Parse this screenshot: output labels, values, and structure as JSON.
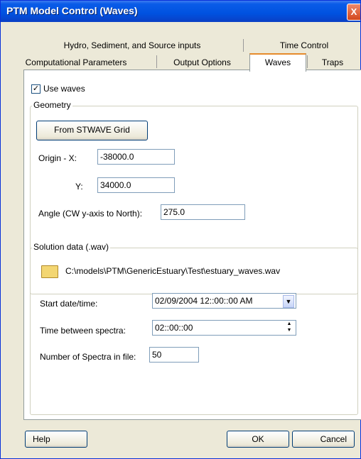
{
  "window": {
    "title": "PTM Model Control (Waves)",
    "close_glyph": "X"
  },
  "tabs": {
    "row1": [
      "Hydro, Sediment, and Source inputs",
      "Time Control"
    ],
    "row2": [
      "Computational Parameters",
      "Output Options",
      "Waves",
      "Traps"
    ],
    "active": "Waves"
  },
  "use_waves": {
    "label": "Use waves",
    "checked": true,
    "mark": "✓"
  },
  "geometry": {
    "title": "Geometry",
    "from_grid_button": "From STWAVE Grid",
    "origin_label": "Origin -  X:",
    "origin_x": "-38000.0",
    "y_label": "Y:",
    "origin_y": "34000.0",
    "angle_label": "Angle (CW y-axis to North):",
    "angle": "275.0"
  },
  "solution": {
    "title": "Solution data (.wav)",
    "file_path": "C:\\models\\PTM\\GenericEstuary\\Test\\estuary_waves.wav",
    "start_label": "Start date/time:",
    "start_value": "02/09/2004  12::00::00 AM",
    "interval_label": "Time between spectra:",
    "interval_value": "02::00::00",
    "count_label": "Number of Spectra in file:",
    "count_value": "50"
  },
  "buttons": {
    "help": "Help",
    "ok": "OK",
    "cancel": "Cancel"
  },
  "icons": {
    "folder": "folder-icon",
    "dropdown": "▼",
    "spin_up": "▲",
    "spin_down": "▼"
  }
}
